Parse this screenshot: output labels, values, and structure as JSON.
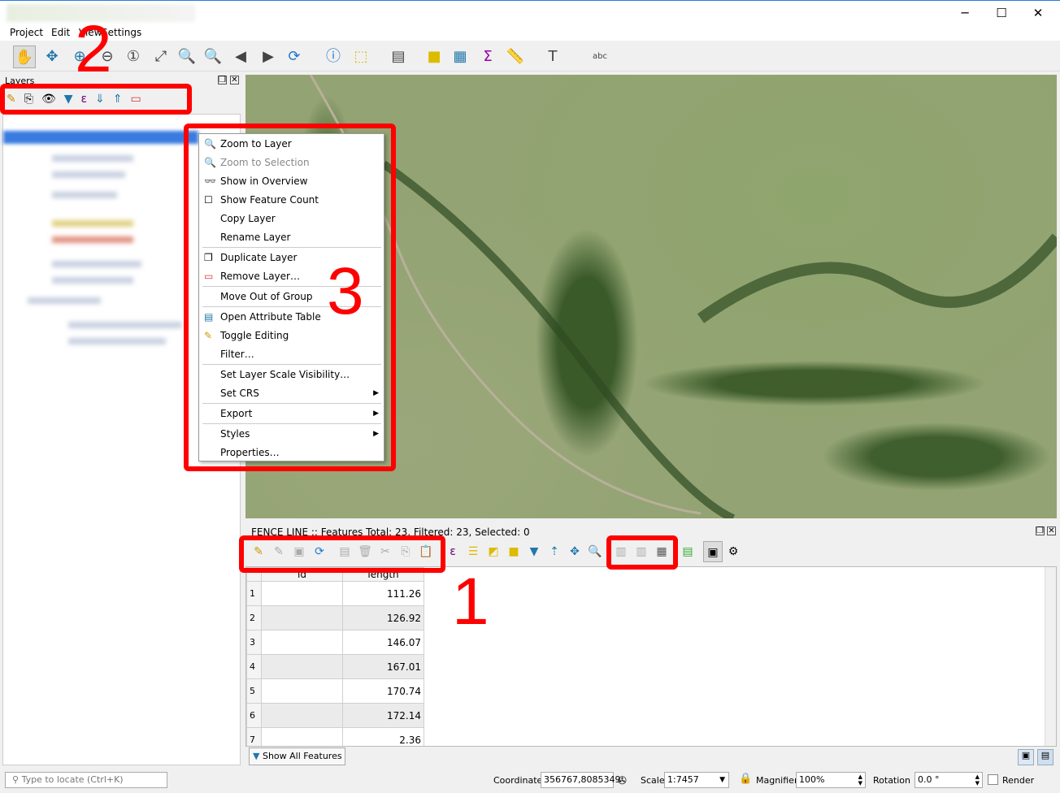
{
  "window": {
    "minimize": "─",
    "maximize": "☐",
    "close": "✕"
  },
  "menu": [
    "Project",
    "Edit",
    "View",
    "Settings"
  ],
  "toolbar_icons": [
    "pan-hand-icon",
    "pan-to-selection-icon",
    "zoom-in-icon",
    "zoom-out-icon",
    "zoom-native-icon",
    "zoom-full-icon",
    "zoom-to-selection-icon",
    "zoom-to-layer-icon",
    "zoom-last-icon",
    "zoom-next-icon",
    "refresh-icon",
    "identify-icon",
    "select-features-icon",
    "select-by-value-icon",
    "deselect-icon",
    "attribute-table-icon",
    "statistics-icon",
    "measure-icon",
    "text-annotation-icon",
    "label-icon"
  ],
  "layers": {
    "title": "Layers"
  },
  "context_menu": [
    {
      "label": "Zoom to Layer",
      "icon": "🔍",
      "disabled": false
    },
    {
      "label": "Zoom to Selection",
      "icon": "🔍",
      "disabled": true
    },
    {
      "label": "Show in Overview",
      "icon": "👓",
      "disabled": false
    },
    {
      "label": "Show Feature Count",
      "icon": "☐",
      "disabled": false
    },
    {
      "label": "Copy Layer",
      "icon": "",
      "disabled": false
    },
    {
      "label": "Rename Layer",
      "icon": "",
      "disabled": false
    },
    {
      "label": "Duplicate Layer",
      "icon": "❐",
      "disabled": false
    },
    {
      "label": "Remove Layer…",
      "icon": "▭",
      "disabled": false
    },
    {
      "label": "Move Out of Group",
      "icon": "",
      "disabled": false
    },
    {
      "label": "Open Attribute Table",
      "icon": "▤",
      "disabled": false
    },
    {
      "label": "Toggle Editing",
      "icon": "✎",
      "disabled": false
    },
    {
      "label": "Filter…",
      "icon": "",
      "disabled": false
    },
    {
      "label": "Set Layer Scale Visibility…",
      "icon": "",
      "disabled": false
    },
    {
      "label": "Set CRS",
      "icon": "",
      "disabled": false,
      "submenu": true
    },
    {
      "label": "Export",
      "icon": "",
      "disabled": false,
      "submenu": true
    },
    {
      "label": "Styles",
      "icon": "",
      "disabled": false,
      "submenu": true
    },
    {
      "label": "Properties…",
      "icon": "",
      "disabled": false
    }
  ],
  "annotations": {
    "one": "1",
    "two": "2",
    "three": "3"
  },
  "attribute_table": {
    "title": "FENCE LINE :: Features Total: 23, Filtered: 23, Selected: 0",
    "columns": [
      "id",
      "length"
    ],
    "rows": [
      [
        "1",
        "",
        "111.26"
      ],
      [
        "2",
        "",
        "126.92"
      ],
      [
        "3",
        "",
        "146.07"
      ],
      [
        "4",
        "",
        "167.01"
      ],
      [
        "5",
        "",
        "170.74"
      ],
      [
        "6",
        "",
        "172.14"
      ],
      [
        "7",
        "",
        "2.36"
      ]
    ],
    "show_all": "Show All Features"
  },
  "status": {
    "locate_placeholder": "Type to locate (Ctrl+K)",
    "coordinate_label": "Coordinate",
    "coordinate": "356767,8085349",
    "scale_label": "Scale",
    "scale": "1:7457",
    "magnifier_label": "Magnifier",
    "magnifier": "100%",
    "rotation_label": "Rotation",
    "rotation": "0.0 °",
    "render_label": "Render"
  },
  "colors": {
    "annotation": "#ff0000",
    "title_accent": "#2b7bd6"
  }
}
